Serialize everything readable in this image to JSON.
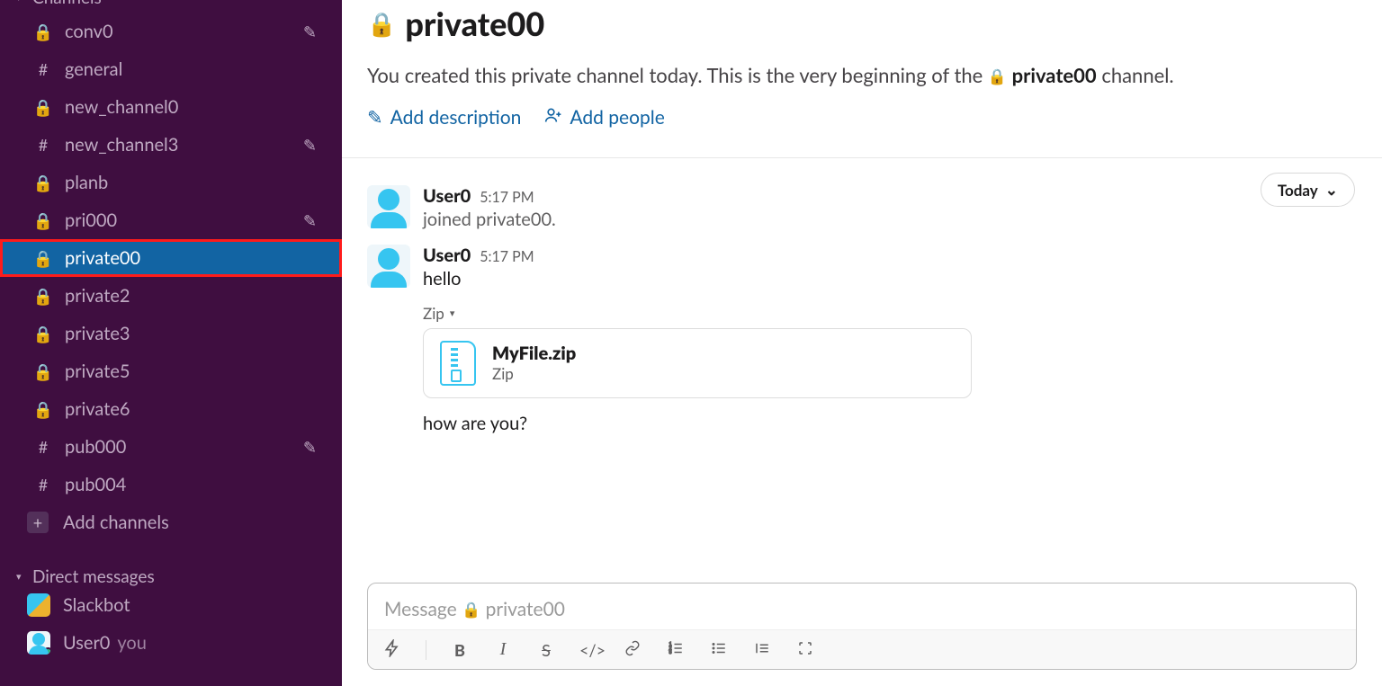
{
  "sidebar": {
    "channels_header": "Channels",
    "channels": [
      {
        "name": "conv0",
        "private": true,
        "editable": true,
        "selected": false
      },
      {
        "name": "general",
        "private": false,
        "editable": false,
        "selected": false
      },
      {
        "name": "new_channel0",
        "private": true,
        "editable": false,
        "selected": false
      },
      {
        "name": "new_channel3",
        "private": false,
        "editable": true,
        "selected": false
      },
      {
        "name": "planb",
        "private": true,
        "editable": false,
        "selected": false
      },
      {
        "name": "pri000",
        "private": true,
        "editable": true,
        "selected": false
      },
      {
        "name": "private00",
        "private": true,
        "editable": false,
        "selected": true,
        "highlight": true
      },
      {
        "name": "private2",
        "private": true,
        "editable": false,
        "selected": false
      },
      {
        "name": "private3",
        "private": true,
        "editable": false,
        "selected": false
      },
      {
        "name": "private5",
        "private": true,
        "editable": false,
        "selected": false
      },
      {
        "name": "private6",
        "private": true,
        "editable": false,
        "selected": false
      },
      {
        "name": "pub000",
        "private": false,
        "editable": true,
        "selected": false
      },
      {
        "name": "pub004",
        "private": false,
        "editable": false,
        "selected": false
      }
    ],
    "add_channels": "Add channels",
    "dm_header": "Direct messages",
    "dms": [
      {
        "name": "Slackbot",
        "kind": "slackbot"
      },
      {
        "name": "User0",
        "kind": "user0",
        "you_label": "you"
      }
    ]
  },
  "header": {
    "title": "private00",
    "intro_prefix": "You created this private channel today. This is the very beginning of the ",
    "intro_channel": "private00",
    "intro_suffix": " channel.",
    "add_description": "Add description",
    "add_people": "Add people"
  },
  "divider": {
    "label": "Today"
  },
  "messages": [
    {
      "user": "User0",
      "time": "5:17 PM",
      "text": "joined private00.",
      "system": true
    },
    {
      "user": "User0",
      "time": "5:17 PM",
      "text": "hello",
      "system": false,
      "attachment_label": "Zip",
      "attachment": {
        "name": "MyFile.zip",
        "type": "Zip"
      },
      "followup": "how are you?"
    }
  ],
  "composer": {
    "placeholder_prefix": "Message ",
    "placeholder_channel": "private00"
  }
}
